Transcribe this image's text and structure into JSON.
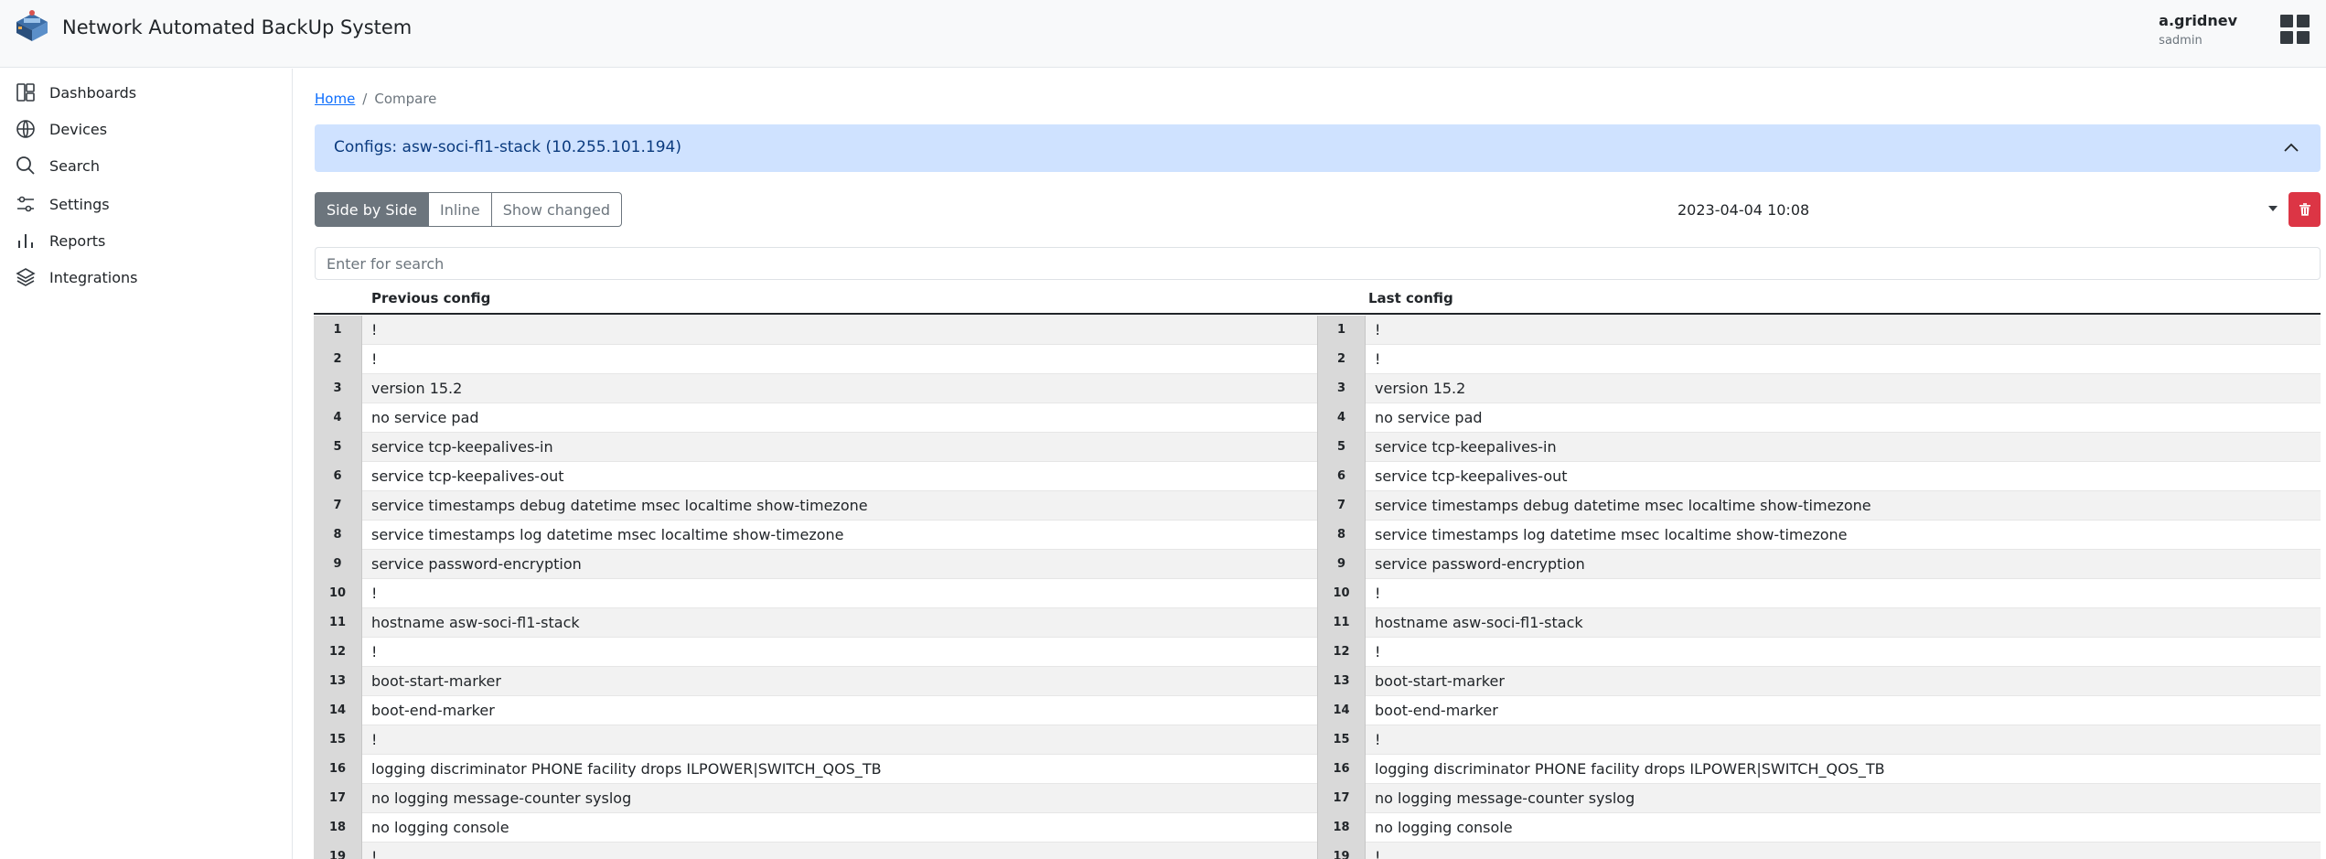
{
  "app": {
    "title": "Network Automated BackUp System"
  },
  "user": {
    "name": "a.gridnev",
    "role": "sadmin"
  },
  "sidebar": {
    "items": [
      {
        "label": "Dashboards",
        "icon": "dashboard-icon"
      },
      {
        "label": "Devices",
        "icon": "globe-icon"
      },
      {
        "label": "Search",
        "icon": "search-icon"
      },
      {
        "label": "Settings",
        "icon": "sliders-icon"
      },
      {
        "label": "Reports",
        "icon": "bar-chart-icon"
      },
      {
        "label": "Integrations",
        "icon": "layers-icon"
      }
    ]
  },
  "breadcrumb": {
    "home": "Home",
    "separator": "/",
    "current": "Compare"
  },
  "accordion": {
    "title": "Configs: asw-soci-fl1-stack (10.255.101.194)"
  },
  "view_modes": {
    "side_by_side": "Side by Side",
    "inline": "Inline",
    "show_changed": "Show changed",
    "active": "Side by Side"
  },
  "date_select": {
    "value": "2023-04-04 10:08"
  },
  "search": {
    "placeholder": "Enter for search"
  },
  "diff": {
    "left_title": "Previous config",
    "right_title": "Last config",
    "lines": [
      {
        "num": "1",
        "left": "!",
        "right": "!"
      },
      {
        "num": "2",
        "left": "!",
        "right": "!"
      },
      {
        "num": "3",
        "left": "version 15.2",
        "right": "version 15.2"
      },
      {
        "num": "4",
        "left": "no service pad",
        "right": "no service pad"
      },
      {
        "num": "5",
        "left": "service tcp-keepalives-in",
        "right": "service tcp-keepalives-in"
      },
      {
        "num": "6",
        "left": "service tcp-keepalives-out",
        "right": "service tcp-keepalives-out"
      },
      {
        "num": "7",
        "left": "service timestamps debug datetime msec localtime show-timezone",
        "right": "service timestamps debug datetime msec localtime show-timezone"
      },
      {
        "num": "8",
        "left": "service timestamps log datetime msec localtime show-timezone",
        "right": "service timestamps log datetime msec localtime show-timezone"
      },
      {
        "num": "9",
        "left": "service password-encryption",
        "right": "service password-encryption"
      },
      {
        "num": "10",
        "left": "!",
        "right": "!"
      },
      {
        "num": "11",
        "left": "hostname asw-soci-fl1-stack",
        "right": "hostname asw-soci-fl1-stack"
      },
      {
        "num": "12",
        "left": "!",
        "right": "!"
      },
      {
        "num": "13",
        "left": "boot-start-marker",
        "right": "boot-start-marker"
      },
      {
        "num": "14",
        "left": "boot-end-marker",
        "right": "boot-end-marker"
      },
      {
        "num": "15",
        "left": "!",
        "right": "!"
      },
      {
        "num": "16",
        "left": "logging discriminator PHONE facility drops ILPOWER|SWITCH_QOS_TB",
        "right": "logging discriminator PHONE facility drops ILPOWER|SWITCH_QOS_TB"
      },
      {
        "num": "17",
        "left": "no logging message-counter syslog",
        "right": "no logging message-counter syslog"
      },
      {
        "num": "18",
        "left": "no logging console",
        "right": "no logging console"
      },
      {
        "num": "19",
        "left": "!",
        "right": "!"
      }
    ]
  }
}
